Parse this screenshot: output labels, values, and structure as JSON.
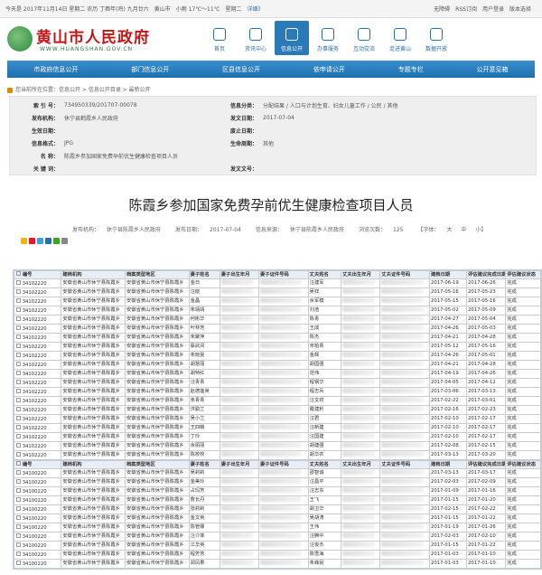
{
  "topbar": {
    "date": "今天是 2017年11月14日 星期二 农历 丁酉年(鸡) 九月廿六",
    "city": "黄山市",
    "weather": "小雨 17℃～11℃",
    "day": "星期二",
    "detail": "详细》",
    "accessibility": "无障碍",
    "rss": "RSS订阅",
    "login": "用户登录",
    "version": "版本选择"
  },
  "header": {
    "site_title": "黄山市人民政府",
    "domain": "WWW.HUANGSHAN.GOV.CN",
    "nav_icons": [
      {
        "label": "首页",
        "active": false
      },
      {
        "label": "资讯中心",
        "active": false
      },
      {
        "label": "信息公开",
        "active": true
      },
      {
        "label": "办事服务",
        "active": false
      },
      {
        "label": "互动交流",
        "active": false
      },
      {
        "label": "走进黄山",
        "active": false
      },
      {
        "label": "数据开放",
        "active": false
      }
    ]
  },
  "mainnav": [
    "市政府信息公开",
    "部门信息公开",
    "区县信息公开",
    "依申请公开",
    "专题专栏",
    "公开意见箱"
  ],
  "breadcrumb": "您当前所在位置：信息公开 > 信息公开目录 > 最新公开",
  "meta": {
    "index_label": "索 引 号：",
    "index": "734950339/201707-00078",
    "category_label": "信息分类：",
    "category": "分配结果 / 人口与计划生育、妇女儿童工作 / 公民 / 其他",
    "org_label": "发布机构：",
    "org": "休宁县鹤霞乡人民政府",
    "pubdate_label": "发文日期：",
    "pubdate": "2017-07-04",
    "effdate_label": "生效日期：",
    "effdate": "",
    "abolish_label": "废止日期：",
    "abolish": "",
    "format_label": "信息格式：",
    "format": "JPG",
    "lifecycle_label": "生命周期：",
    "lifecycle": "其他",
    "name_label": "名 称：",
    "name": "陈霞乡参加国家免费孕前优生健康检查项目人员",
    "keyword_label": "关 键 词：",
    "keyword": "",
    "docno_label": "发文文号：",
    "docno": ""
  },
  "article": {
    "title": "陈霞乡参加国家免费孕前优生健康检查项目人员",
    "org_label": "发布机构：",
    "org": "休宁县陈霞乡人民政府",
    "date_label": "发布日期：",
    "date": "2017-07-04",
    "source_label": "信息来源：",
    "source": "休宁县陈霞乡人民政府",
    "views_label": "浏览次数：",
    "views": "125",
    "font_label": "【字体：",
    "font_big": "大",
    "font_mid": "中",
    "font_small": "小】"
  },
  "table_headers": [
    "编号",
    "建档机构",
    "档案类型地区",
    "妻子姓名",
    "妻子出生年月",
    "妻子证件号码",
    "丈夫姓名",
    "丈夫出生年月",
    "丈夫证件号码",
    "建档日期",
    "评估建议完成日期",
    "评估建议状态"
  ],
  "table1": [
    [
      "34102220",
      "安徽省黄山市休宁县陈霞乡",
      "安徽省黄山市休宁县陈霞乡",
      "金日",
      "",
      "",
      "汪建军",
      "",
      "",
      "2017-06-19",
      "2017-06-26",
      "完成"
    ],
    [
      "34102220",
      "安徽省黄山市休宁县陈霞乡",
      "安徽省黄山市休宁县陈霞乡",
      "汪晓",
      "",
      "",
      "吴祥",
      "",
      "",
      "2017-05-16",
      "2017-05-23",
      "完成"
    ],
    [
      "34102220",
      "安徽省黄山市休宁县陈霞乡",
      "安徽省黄山市休宁县陈霞乡",
      "金晶",
      "",
      "",
      "余军模",
      "",
      "",
      "2017-05-15",
      "2017-05-16",
      "完成"
    ],
    [
      "34102220",
      "安徽省黄山市休宁县陈霞乡",
      "安徽省黄山市休宁县陈霞乡",
      "朱靖靖",
      "",
      "",
      "刘浩",
      "",
      "",
      "2017-05-02",
      "2017-05-09",
      "完成"
    ],
    [
      "34102220",
      "安徽省黄山市休宁县陈霞乡",
      "安徽省黄山市休宁县陈霞乡",
      "何彬华",
      "",
      "",
      "陈青",
      "",
      "",
      "2017-04-27",
      "2017-05-04",
      "完成"
    ],
    [
      "34102220",
      "安徽省黄山市休宁县陈霞乡",
      "安徽省黄山市休宁县陈霞乡",
      "叶林芳",
      "",
      "",
      "王成",
      "",
      "",
      "2017-04-26",
      "2017-05-03",
      "完成"
    ],
    [
      "34102220",
      "安徽省黄山市休宁县陈霞乡",
      "安徽省黄山市休宁县陈霞乡",
      "朱聚萍",
      "",
      "",
      "陈杰",
      "",
      "",
      "2017-04-21",
      "2017-04-28",
      "完成"
    ],
    [
      "34102220",
      "安徽省黄山市休宁县陈霞乡",
      "安徽省黄山市休宁县陈霞乡",
      "蔡武凤",
      "",
      "",
      "宋柏青",
      "",
      "",
      "2017-05-12",
      "2017-05-16",
      "完成"
    ],
    [
      "34102220",
      "安徽省黄山市休宁县陈霞乡",
      "安徽省黄山市休宁县陈霞乡",
      "朱晓雯",
      "",
      "",
      "金辉",
      "",
      "",
      "2017-04-26",
      "2017-05-01",
      "完成"
    ],
    [
      "34102220",
      "安徽省黄山市休宁县陈霞乡",
      "安徽省黄山市休宁县陈霞乡",
      "胡慧丽",
      "",
      "",
      "胡国强",
      "",
      "",
      "2017-04-21",
      "2017-04-28",
      "完成"
    ],
    [
      "34102220",
      "安徽省黄山市休宁县陈霞乡",
      "安徽省黄山市休宁县陈霞乡",
      "胡特红",
      "",
      "",
      "范伟",
      "",
      "",
      "2017-04-19",
      "2017-04-26",
      "完成"
    ],
    [
      "34102220",
      "安徽省黄山市休宁县陈霞乡",
      "安徽省黄山市休宁县陈霞乡",
      "汪青青",
      "",
      "",
      "程钢华",
      "",
      "",
      "2017-04-05",
      "2017-04-12",
      "完成"
    ],
    [
      "34102220",
      "安徽省黄山市休宁县陈霞乡",
      "安徽省黄山市休宁县陈霞乡",
      "赵德莲英",
      "",
      "",
      "程志兵",
      "",
      "",
      "2017-03-06",
      "2017-03-13",
      "完成"
    ],
    [
      "34102220",
      "安徽省黄山市休宁县陈霞乡",
      "安徽省黄山市休宁县陈霞乡",
      "朱青青",
      "",
      "",
      "汪文祥",
      "",
      "",
      "2017-02-22",
      "2017-03-01",
      "完成"
    ],
    [
      "34102220",
      "安徽省黄山市休宁县陈霞乡",
      "安徽省黄山市休宁县陈霞乡",
      "洪勤兰",
      "",
      "",
      "戴建利",
      "",
      "",
      "2017-02-16",
      "2017-02-23",
      "完成"
    ],
    [
      "34102220",
      "安徽省黄山市休宁县陈霞乡",
      "安徽省黄山市休宁县陈霞乡",
      "吴小兰",
      "",
      "",
      "汪君",
      "",
      "",
      "2017-02-10",
      "2017-02-17",
      "完成"
    ],
    [
      "34102220",
      "安徽省黄山市休宁县陈霞乡",
      "安徽省黄山市休宁县陈霞乡",
      "王四娥",
      "",
      "",
      "汪新建",
      "",
      "",
      "2017-02-10",
      "2017-02-17",
      "完成"
    ],
    [
      "34102220",
      "安徽省黄山市休宁县陈霞乡",
      "安徽省黄山市休宁县陈霞乡",
      "丁玲",
      "",
      "",
      "汪国建",
      "",
      "",
      "2017-02-10",
      "2017-02-17",
      "完成"
    ],
    [
      "34102220",
      "安徽省黄山市休宁县陈霞乡",
      "安徽省黄山市休宁县陈霞乡",
      "余丽丽",
      "",
      "",
      "胡建强",
      "",
      "",
      "2017-02-08",
      "2017-02-15",
      "完成"
    ],
    [
      "34102220",
      "安徽省黄山市休宁县陈霞乡",
      "安徽省黄山市休宁县陈霞乡",
      "陈校校",
      "",
      "",
      "胡华农",
      "",
      "",
      "2017-03-13",
      "2017-03-20",
      "完成"
    ]
  ],
  "table2": [
    [
      "34100220",
      "安徽省黄山市休宁县陈霞乡",
      "安徽省黄山市休宁县陈霞乡",
      "吴莉莉",
      "",
      "",
      "邵智诚",
      "",
      "",
      "2017-03-13",
      "2017-03-17",
      "完成"
    ],
    [
      "34100220",
      "安徽省黄山市休宁县陈霞乡",
      "安徽省黄山市休宁县陈霞乡",
      "金美玲",
      "",
      "",
      "汪昌平",
      "",
      "",
      "2017-02-03",
      "2017-02-09",
      "完成"
    ],
    [
      "34100220",
      "安徽省黄山市休宁县陈霞乡",
      "安徽省黄山市休宁县陈霞乡",
      "占玛芳",
      "",
      "",
      "汪志东",
      "",
      "",
      "2017-01-09",
      "2017-01-16",
      "完成"
    ],
    [
      "34100220",
      "安徽省黄山市休宁县陈霞乡",
      "安徽省黄山市休宁县陈霞乡",
      "詹长丹",
      "",
      "",
      "王飞",
      "",
      "",
      "2017-01-15",
      "2017-01-20",
      "完成"
    ],
    [
      "34100220",
      "安徽省黄山市休宁县陈霞乡",
      "安徽省黄山市休宁县陈霞乡",
      "张莉莉",
      "",
      "",
      "胡卫华",
      "",
      "",
      "2017-02-15",
      "2017-02-22",
      "完成"
    ],
    [
      "34100220",
      "安徽省黄山市休宁县陈霞乡",
      "安徽省黄山市休宁县陈霞乡",
      "金文英",
      "",
      "",
      "吴胡涛",
      "",
      "",
      "2017-01-15",
      "2017-01-22",
      "完成"
    ],
    [
      "34100220",
      "安徽省黄山市休宁县陈霞乡",
      "安徽省黄山市休宁县陈霞乡",
      "陈管娜",
      "",
      "",
      "王伟",
      "",
      "",
      "2017-01-19",
      "2017-01-26",
      "完成"
    ],
    [
      "34100220",
      "安徽省黄山市休宁县陈霞乡",
      "安徽省黄山市休宁县陈霞乡",
      "汪介菲",
      "",
      "",
      "汪腾中",
      "",
      "",
      "2017-02-03",
      "2017-02-10",
      "完成"
    ],
    [
      "34100220",
      "安徽省黄山市休宁县陈霞乡",
      "安徽省黄山市休宁县陈霞乡",
      "江华英",
      "",
      "",
      "汪俊杰",
      "",
      "",
      "2017-01-15",
      "2017-01-22",
      "完成"
    ],
    [
      "34100220",
      "安徽省黄山市休宁县陈霞乡",
      "安徽省黄山市休宁县陈霞乡",
      "程芳芳",
      "",
      "",
      "陈雪海",
      "",
      "",
      "2017-01-03",
      "2017-01-10",
      "完成"
    ],
    [
      "34100220",
      "安徽省黄山市休宁县陈霞乡",
      "安徽省黄山市休宁县陈霞乡",
      "郑凤果",
      "",
      "",
      "朱峰民",
      "",
      "",
      "2017-01-03",
      "2017-01-10",
      "完成"
    ]
  ]
}
